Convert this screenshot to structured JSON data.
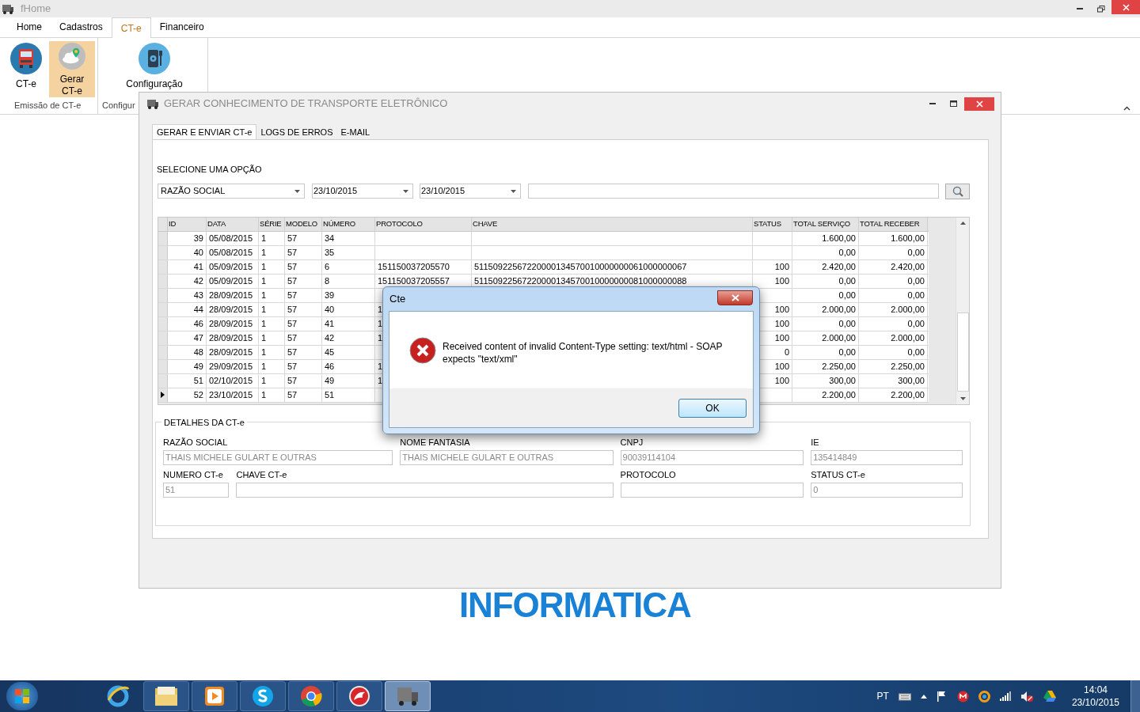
{
  "app_window": {
    "title": "fHome",
    "ribbon_tabs": [
      {
        "label": "Home",
        "selected": false
      },
      {
        "label": "Cadastros",
        "selected": false
      },
      {
        "label": "CT-e",
        "selected": true
      },
      {
        "label": "Financeiro",
        "selected": false
      }
    ],
    "ribbon_groups": [
      {
        "label": "Emissão de CT-e",
        "buttons": [
          {
            "label": "CT-e",
            "selected": false
          },
          {
            "label": "Gerar CT-e",
            "selected": true
          }
        ]
      },
      {
        "label": "Configur",
        "buttons": [
          {
            "label": "Configuração",
            "selected": false
          }
        ]
      }
    ],
    "background_logo": "INFORMATICA"
  },
  "child_window": {
    "title": "GERAR CONHECIMENTO DE TRANSPORTE ELETRÔNICO",
    "tabs": [
      {
        "label": "GERAR E ENVIAR CT-e",
        "selected": true
      },
      {
        "label": "LOGS DE ERROS",
        "selected": false
      },
      {
        "label": "E-MAIL",
        "selected": false
      }
    ],
    "filter": {
      "label": "SELECIONE UMA OPÇÃO",
      "field": "RAZÃO SOCIAL",
      "date_from": "23/10/2015",
      "date_to": "23/10/2015"
    },
    "table": {
      "columns": [
        "ID",
        "DATA",
        "SÉRIE",
        "MODELO",
        "NÚMERO",
        "PROTOCOLO",
        "CHAVE",
        "STATUS",
        "TOTAL SERVIÇO",
        "TOTAL RECEBER"
      ],
      "rows": [
        {
          "current": false,
          "cells": [
            "39",
            "05/08/2015",
            "1",
            "57",
            "34",
            "",
            "",
            "",
            "1.600,00",
            "1.600,00"
          ]
        },
        {
          "current": false,
          "cells": [
            "40",
            "05/08/2015",
            "1",
            "57",
            "35",
            "",
            "",
            "",
            "0,00",
            "0,00"
          ]
        },
        {
          "current": false,
          "cells": [
            "41",
            "05/09/2015",
            "1",
            "57",
            "6",
            "151150037205570",
            "51150922567220000134570010000000061000000067",
            "100",
            "2.420,00",
            "2.420,00"
          ]
        },
        {
          "current": false,
          "cells": [
            "42",
            "05/09/2015",
            "1",
            "57",
            "8",
            "151150037205557",
            "51150922567220000134570010000000081000000088",
            "100",
            "0,00",
            "0,00"
          ]
        },
        {
          "current": false,
          "cells": [
            "43",
            "28/09/2015",
            "1",
            "57",
            "39",
            "",
            "",
            "",
            "0,00",
            "0,00"
          ]
        },
        {
          "current": false,
          "cells": [
            "44",
            "28/09/2015",
            "1",
            "57",
            "40",
            "1",
            "",
            "100",
            "2.000,00",
            "2.000,00"
          ]
        },
        {
          "current": false,
          "cells": [
            "46",
            "28/09/2015",
            "1",
            "57",
            "41",
            "1",
            "",
            "100",
            "0,00",
            "0,00"
          ]
        },
        {
          "current": false,
          "cells": [
            "47",
            "28/09/2015",
            "1",
            "57",
            "42",
            "1",
            "",
            "100",
            "2.000,00",
            "2.000,00"
          ]
        },
        {
          "current": false,
          "cells": [
            "48",
            "28/09/2015",
            "1",
            "57",
            "45",
            "",
            "",
            "0",
            "0,00",
            "0,00"
          ]
        },
        {
          "current": false,
          "cells": [
            "49",
            "29/09/2015",
            "1",
            "57",
            "46",
            "1",
            "",
            "100",
            "2.250,00",
            "2.250,00"
          ]
        },
        {
          "current": false,
          "cells": [
            "51",
            "02/10/2015",
            "1",
            "57",
            "49",
            "1",
            "",
            "100",
            "300,00",
            "300,00"
          ]
        },
        {
          "current": true,
          "cells": [
            "52",
            "23/10/2015",
            "1",
            "57",
            "51",
            "",
            "",
            "",
            "2.200,00",
            "2.200,00"
          ]
        }
      ]
    },
    "details": {
      "title": "DETALHES DA CT-e",
      "fields": [
        {
          "label": "RAZÃO SOCIAL",
          "value": "THAIS MICHELE GULART E OUTRAS"
        },
        {
          "label": "NOME FANTASIA",
          "value": "THAIS MICHELE GULART E OUTRAS"
        },
        {
          "label": "CNPJ",
          "value": "90039114104"
        },
        {
          "label": "IE",
          "value": "135414849"
        },
        {
          "label": "NUMERO CT-e",
          "value": "51"
        },
        {
          "label": "CHAVE CT-e"
        },
        {
          "label": "PROTOCOLO"
        },
        {
          "label": "STATUS CT-e",
          "value": "0"
        }
      ]
    }
  },
  "dialog": {
    "title": "Cte",
    "message": "Received content of invalid Content-Type setting: text/html - SOAP expects \"text/xml\"",
    "button": "OK"
  },
  "taskbar": {
    "apps": [
      {
        "active": false
      },
      {
        "active": false
      },
      {
        "active": false
      },
      {
        "active": false
      },
      {
        "active": false
      },
      {
        "active": false
      },
      {
        "active": true
      }
    ],
    "language": "PT",
    "time": "14:04",
    "date": "23/10/2015"
  }
}
